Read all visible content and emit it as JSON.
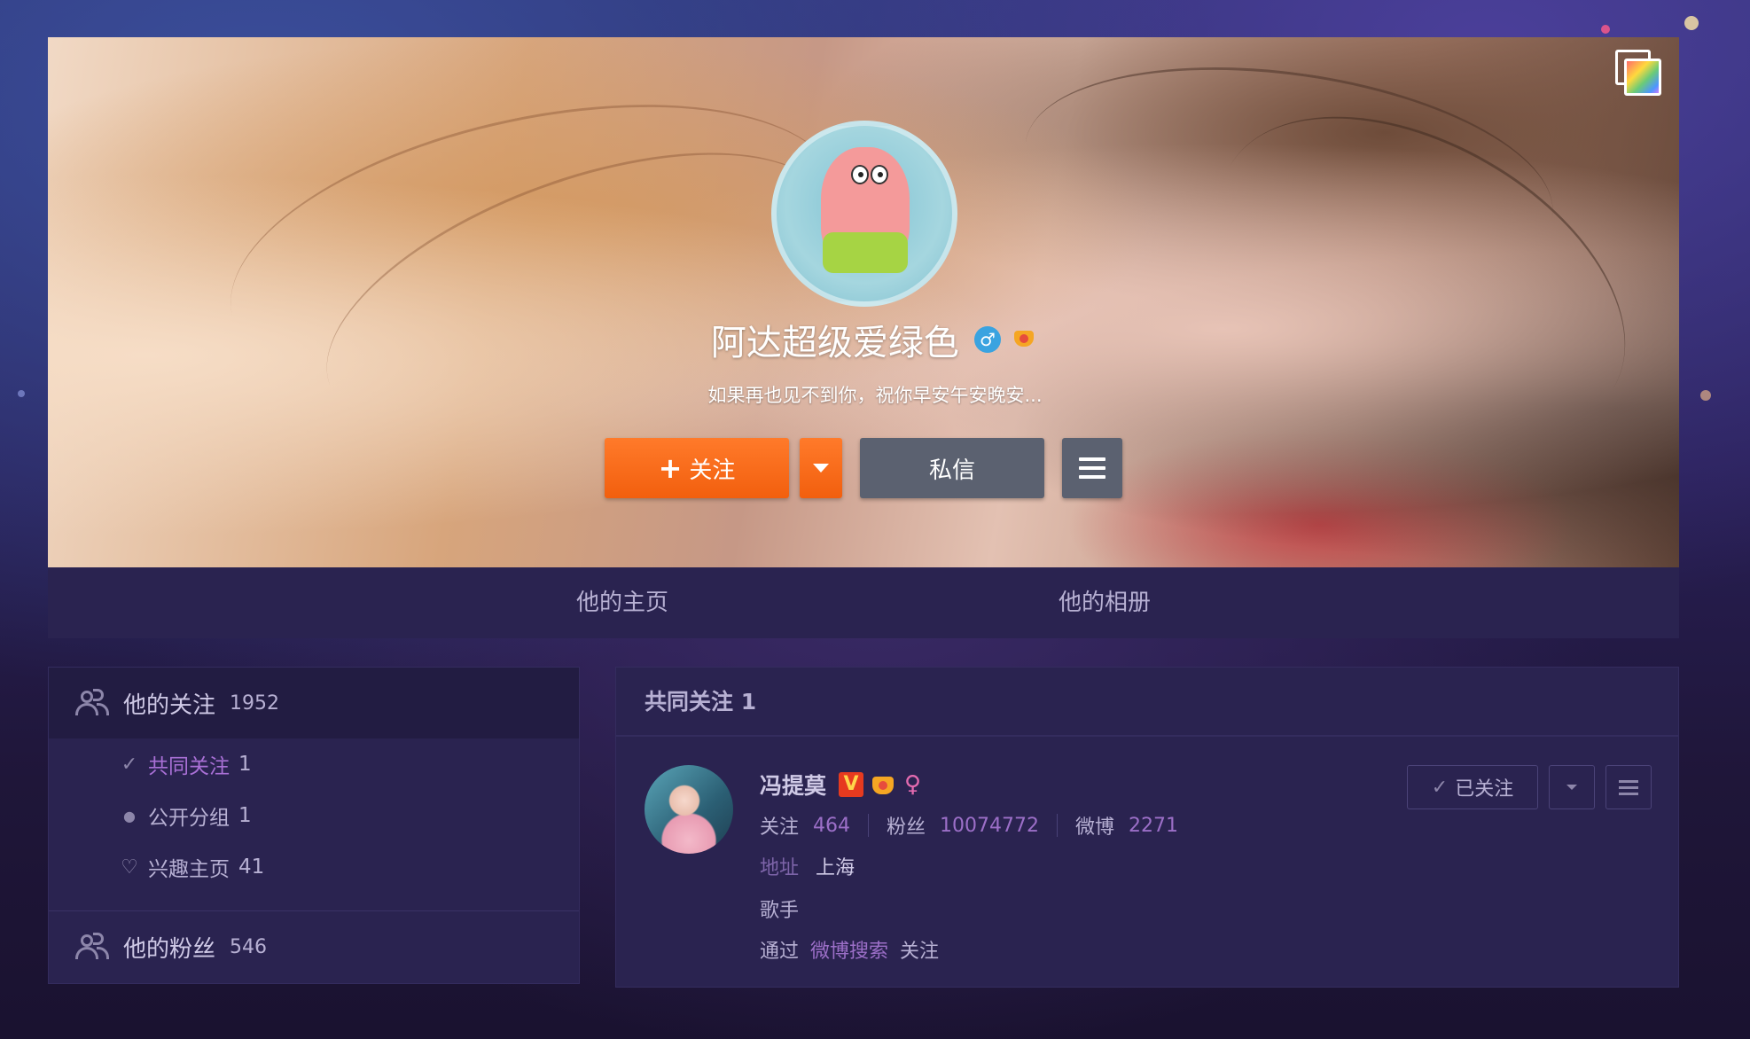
{
  "cover": {
    "name": "阿达超级爱绿色",
    "bio": "如果再也见不到你，祝你早安午安晚安...",
    "gender_icon": "male-icon",
    "follow_label": "关注",
    "follow_plus": "+",
    "message_label": "私信"
  },
  "tabs": [
    {
      "label": "他的主页"
    },
    {
      "label": "他的相册"
    }
  ],
  "sidebar": {
    "following_title": "他的关注",
    "following_count": "1952",
    "items": [
      {
        "icon": "check-icon",
        "label": "共同关注",
        "count": "1"
      },
      {
        "icon": "dot-icon",
        "label": "公开分组",
        "count": "1"
      },
      {
        "icon": "heart-icon",
        "label": "兴趣主页",
        "count": "41"
      }
    ],
    "fans_title": "他的粉丝",
    "fans_count": "546"
  },
  "panel": {
    "title": "共同关注 1",
    "user": {
      "name": "冯提莫",
      "verified_badge": "V",
      "following_label": "关注",
      "following": "464",
      "fans_label": "粉丝",
      "fans": "10074772",
      "weibo_label": "微博",
      "weibo": "2271",
      "address_label": "地址",
      "address": "上海",
      "description": "歌手",
      "via_prefix": "通过",
      "via_link": "微博搜索",
      "via_suffix": "关注",
      "followed_label": "已关注"
    }
  },
  "colors": {
    "accent_orange": "#f25f0e",
    "link_purple": "#9c6fc8",
    "panel_bg": "#2a2350"
  }
}
